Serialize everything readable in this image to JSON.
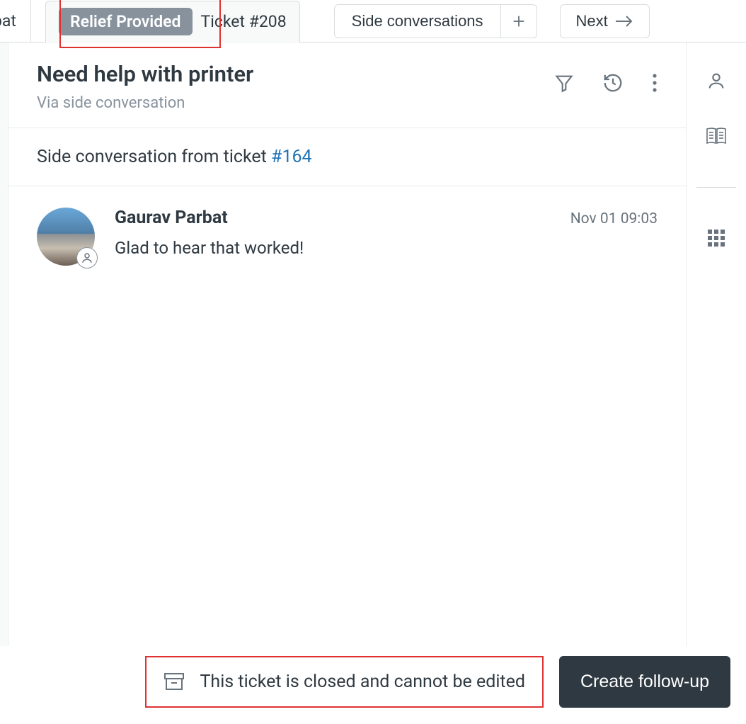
{
  "tabs": {
    "partial_label": "bat",
    "active": {
      "badge": "Relief Provided",
      "label": "Ticket #208"
    }
  },
  "toolbar": {
    "side_conversations": "Side conversations",
    "next": "Next"
  },
  "header": {
    "subject": "Need help with printer",
    "via": "Via side conversation"
  },
  "linked": {
    "prefix": "Side conversation from ticket ",
    "ticket_ref": "#164"
  },
  "message": {
    "author": "Gaurav Parbat",
    "timestamp": "Nov 01 09:03",
    "body": "Glad to hear that worked!"
  },
  "footer": {
    "closed_notice": "This ticket is closed and cannot be edited",
    "followup": "Create follow-up"
  }
}
